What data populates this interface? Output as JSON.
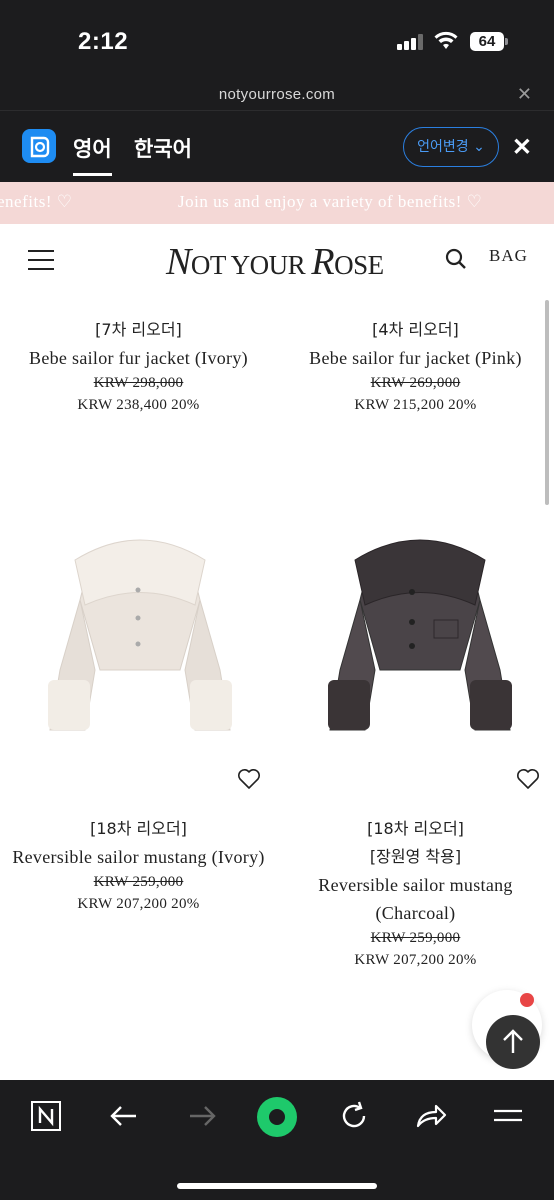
{
  "status_bar": {
    "time": "2:12",
    "battery": "64"
  },
  "url_bar": {
    "url": "notyourrose.com"
  },
  "translate_bar": {
    "tab_english": "영어",
    "tab_korean": "한국어",
    "change_language": "언어변경"
  },
  "banner": {
    "text": "Join us and enjoy a variety of benefits! ♡",
    "left_fragment": "benefits! ♡"
  },
  "header": {
    "logo_n": "N",
    "logo_ot_your": "OT YOUR ",
    "logo_r": "R",
    "logo_ose": "OSE",
    "bag_label": "BAG"
  },
  "products": [
    {
      "tag": "[7차 리오더]",
      "name": "Bebe sailor fur jacket (Ivory)",
      "old_price": "KRW 298,000",
      "new_price": "KRW 238,400 20%"
    },
    {
      "tag": "[4차 리오더]",
      "name": "Bebe sailor fur jacket (Pink)",
      "old_price": "KRW 269,000",
      "new_price": "KRW 215,200 20%"
    },
    {
      "tag": "[18차 리오더]",
      "name": "Reversible sailor mustang (Ivory)",
      "old_price": "KRW 259,000",
      "new_price": "KRW 207,200 20%",
      "image_color": "#ece6e0"
    },
    {
      "tag": "[18차 리오더]",
      "tag2": "[장원영 착용]",
      "name_line1": "Reversible sailor mustang",
      "name_line2": "(Charcoal)",
      "old_price": "KRW 259,000",
      "new_price": "KRW 207,200 20%",
      "image_color": "#4a4448"
    }
  ],
  "colors": {
    "accent_pink": "#f4d8d6",
    "papago_blue": "#1e8cf2",
    "navi_green": "#1ec96b"
  }
}
